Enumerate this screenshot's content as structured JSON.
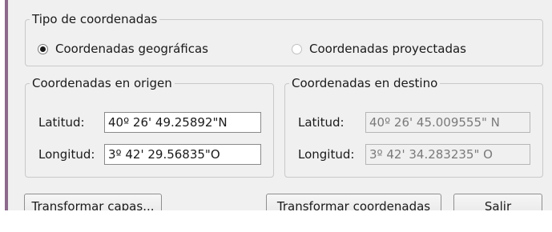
{
  "coordinate_type": {
    "legend": "Tipo de coordenadas",
    "options": [
      {
        "label": "Coordenadas geográficas",
        "checked": true
      },
      {
        "label": "Coordenadas proyectadas",
        "checked": false
      }
    ]
  },
  "origin": {
    "legend": "Coordenadas en origen",
    "latitude_label": "Latitud:",
    "latitude_value": "40º 26' 49.25892\"N",
    "longitude_label": "Longitud:",
    "longitude_value": "3º 42' 29.56835\"O"
  },
  "destination": {
    "legend": "Coordenadas en destino",
    "latitude_label": "Latitud:",
    "latitude_value": "40º 26' 45.009555\" N",
    "longitude_label": "Longitud:",
    "longitude_value": "3º 42' 34.283235\" O"
  },
  "buttons": {
    "transform_layers": "Transformar capas...",
    "transform_coordinates": "Transformar coordenadas",
    "exit": "Salir"
  }
}
